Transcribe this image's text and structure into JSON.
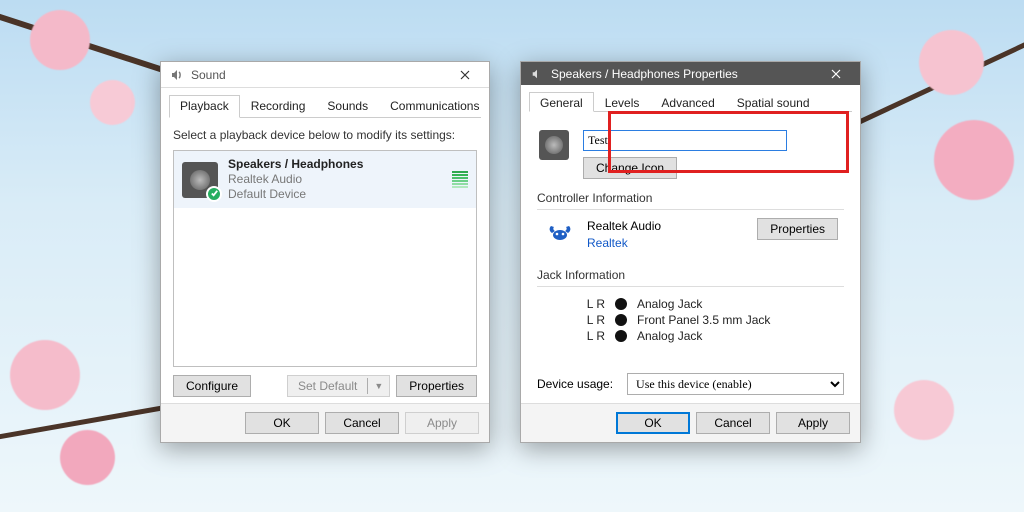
{
  "sound_window": {
    "title": "Sound",
    "tabs": [
      "Playback",
      "Recording",
      "Sounds",
      "Communications"
    ],
    "active_tab": 0,
    "hint": "Select a playback device below to modify its settings:",
    "devices": [
      {
        "name": "Speakers / Headphones",
        "driver": "Realtek Audio",
        "status": "Default Device"
      }
    ],
    "buttons": {
      "configure": "Configure",
      "set_default": "Set Default",
      "properties": "Properties"
    },
    "footer": {
      "ok": "OK",
      "cancel": "Cancel",
      "apply": "Apply"
    }
  },
  "props_window": {
    "title": "Speakers / Headphones Properties",
    "tabs": [
      "General",
      "Levels",
      "Advanced",
      "Spatial sound"
    ],
    "active_tab": 0,
    "name_value": "Test",
    "change_icon": "Change Icon",
    "controller": {
      "section": "Controller Information",
      "name": "Realtek Audio",
      "vendor": "Realtek",
      "properties": "Properties"
    },
    "jack": {
      "section": "Jack Information",
      "items": [
        {
          "lr": "L R",
          "label": "Analog Jack"
        },
        {
          "lr": "L R",
          "label": "Front Panel 3.5 mm Jack"
        },
        {
          "lr": "L R",
          "label": "Analog Jack"
        }
      ]
    },
    "usage": {
      "label": "Device usage:",
      "selected": "Use this device (enable)"
    },
    "footer": {
      "ok": "OK",
      "cancel": "Cancel",
      "apply": "Apply"
    }
  }
}
